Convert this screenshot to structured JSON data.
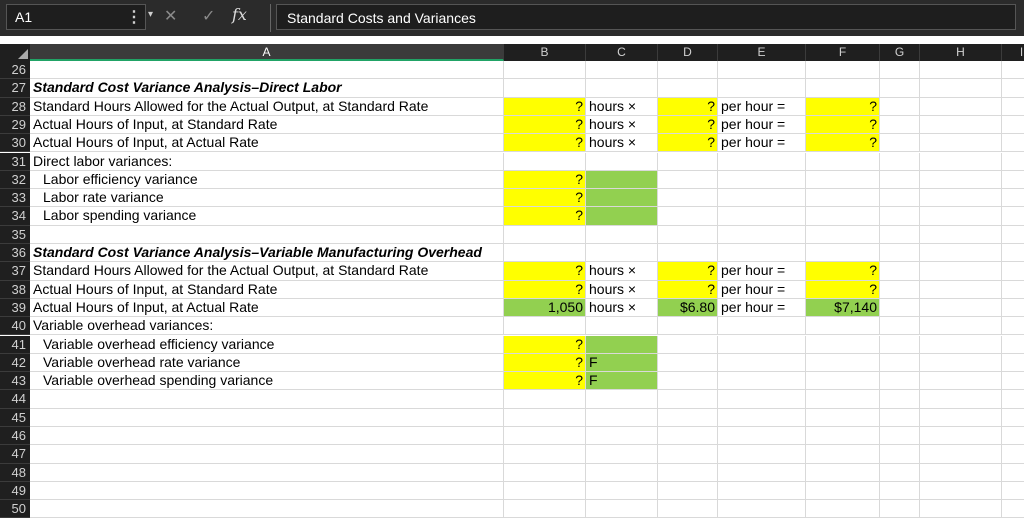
{
  "name_box": "A1",
  "formula_bar": {
    "fx": "fx",
    "content": "Standard Costs and Variances"
  },
  "columns": [
    "A",
    "B",
    "C",
    "D",
    "E",
    "F",
    "G",
    "H",
    "I"
  ],
  "rows": [
    {
      "num": "26"
    },
    {
      "num": "27",
      "A": "Standard Cost Variance Analysis–Direct Labor",
      "A_style": "bold-it"
    },
    {
      "num": "28",
      "A": "Standard Hours Allowed for the Actual Output, at Standard Rate",
      "B": "?",
      "C": "hours ×",
      "D": "?",
      "E": "per hour =",
      "F": "?",
      "B_fill": "yellow",
      "D_fill": "yellow",
      "F_fill": "yellow"
    },
    {
      "num": "29",
      "A": "Actual Hours of Input, at Standard Rate",
      "B": "?",
      "C": "hours ×",
      "D": "?",
      "E": "per hour =",
      "F": "?",
      "B_fill": "yellow",
      "D_fill": "yellow",
      "F_fill": "yellow"
    },
    {
      "num": "30",
      "A": "Actual Hours of Input, at Actual Rate",
      "B": "?",
      "C": "hours ×",
      "D": "?",
      "E": "per hour =",
      "F": "?",
      "B_fill": "yellow",
      "D_fill": "yellow",
      "F_fill": "yellow"
    },
    {
      "num": "31",
      "A": "Direct labor variances:"
    },
    {
      "num": "32",
      "A": "Labor efficiency variance",
      "A_style": "indent",
      "B": "?",
      "B_fill": "yellow",
      "C_fill": "green"
    },
    {
      "num": "33",
      "A": "Labor rate variance",
      "A_style": "indent",
      "B": "?",
      "B_fill": "yellow",
      "C_fill": "green"
    },
    {
      "num": "34",
      "A": "Labor spending variance",
      "A_style": "indent",
      "B": "?",
      "B_fill": "yellow",
      "C_fill": "green"
    },
    {
      "num": "35"
    },
    {
      "num": "36",
      "A": "Standard Cost Variance Analysis–Variable Manufacturing Overhead",
      "A_style": "bold-it"
    },
    {
      "num": "37",
      "A": "Standard Hours Allowed for the Actual Output, at Standard Rate",
      "B": "?",
      "C": "hours ×",
      "D": "?",
      "E": "per hour =",
      "F": "?",
      "B_fill": "yellow",
      "D_fill": "yellow",
      "F_fill": "yellow"
    },
    {
      "num": "38",
      "A": "Actual Hours of Input, at Standard Rate",
      "B": "?",
      "C": "hours ×",
      "D": "?",
      "E": "per hour =",
      "F": "?",
      "B_fill": "yellow",
      "D_fill": "yellow",
      "F_fill": "yellow"
    },
    {
      "num": "39",
      "A": "Actual Hours of Input, at Actual Rate",
      "B": "1,050",
      "C": "hours ×",
      "D": "$6.80",
      "E": "per hour =",
      "F": "$7,140",
      "B_fill": "green",
      "D_fill": "green",
      "F_fill": "green"
    },
    {
      "num": "40",
      "A": "Variable overhead variances:"
    },
    {
      "num": "41",
      "A": "Variable overhead efficiency variance",
      "A_style": "indent",
      "B": "?",
      "B_fill": "yellow",
      "C_fill": "green"
    },
    {
      "num": "42",
      "A": "Variable overhead rate variance",
      "A_style": "indent",
      "B": "?",
      "C": "F",
      "B_fill": "yellow",
      "C_fill": "green"
    },
    {
      "num": "43",
      "A": "Variable overhead spending variance",
      "A_style": "indent",
      "B": "?",
      "C": "F",
      "B_fill": "yellow",
      "C_fill": "green"
    },
    {
      "num": "44"
    },
    {
      "num": "45"
    },
    {
      "num": "46"
    },
    {
      "num": "47"
    },
    {
      "num": "48"
    },
    {
      "num": "49"
    },
    {
      "num": "50"
    }
  ],
  "colors": {
    "yellow": "#ffff00",
    "green": "#92d050",
    "header_bg": "#1f1f1f",
    "selected_col": "#21a366"
  }
}
